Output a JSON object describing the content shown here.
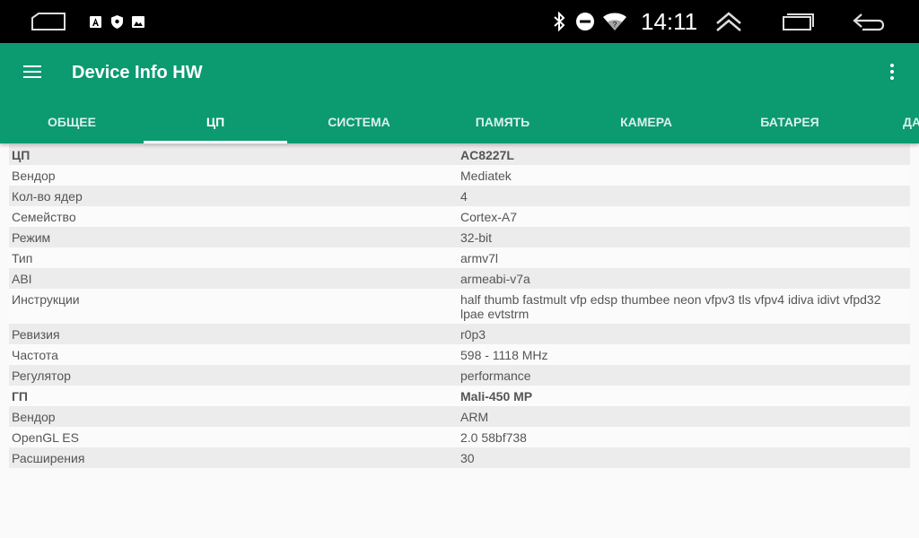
{
  "status_bar": {
    "time": "14:11",
    "icons": [
      "home-outline-icon",
      "notification-a-icon",
      "shield-icon",
      "image-icon",
      "bluetooth-icon",
      "do-not-disturb-icon",
      "wifi-icon",
      "collapse-up-icon",
      "recents-icon",
      "back-icon"
    ]
  },
  "app_bar": {
    "title": "Device Info HW",
    "color": "#0c9a70"
  },
  "tabs": [
    {
      "label": "ОБЩЕЕ"
    },
    {
      "label": "ЦП"
    },
    {
      "label": "СИСТЕМА"
    },
    {
      "label": "ПАМЯТЬ"
    },
    {
      "label": "КАМЕРА"
    },
    {
      "label": "БАТАРЕЯ"
    },
    {
      "label": "ДА"
    }
  ],
  "active_tab": "ЦП",
  "rows": [
    {
      "key": "ЦП",
      "value": "AC8227L",
      "bold": true
    },
    {
      "key": "Вендор",
      "value": "Mediatek"
    },
    {
      "key": "Кол-во ядер",
      "value": "4"
    },
    {
      "key": "Семейство",
      "value": "Cortex-A7"
    },
    {
      "key": "Режим",
      "value": "32-bit"
    },
    {
      "key": "Тип",
      "value": "armv7l"
    },
    {
      "key": "ABI",
      "value": "armeabi-v7a"
    },
    {
      "key": "Инструкции",
      "value": "half thumb fastmult vfp edsp thumbee neon vfpv3 tls vfpv4 idiva idivt vfpd32 lpae evtstrm"
    },
    {
      "key": "Ревизия",
      "value": "r0p3"
    },
    {
      "key": "Частота",
      "value": "598 - 1118 MHz"
    },
    {
      "key": "Регулятор",
      "value": "performance"
    },
    {
      "key": "ГП",
      "value": "Mali-450 MP",
      "bold": true
    },
    {
      "key": "Вендор",
      "value": "ARM"
    },
    {
      "key": "OpenGL ES",
      "value": "2.0 58bf738"
    },
    {
      "key": "Расширения",
      "value": "30"
    }
  ]
}
